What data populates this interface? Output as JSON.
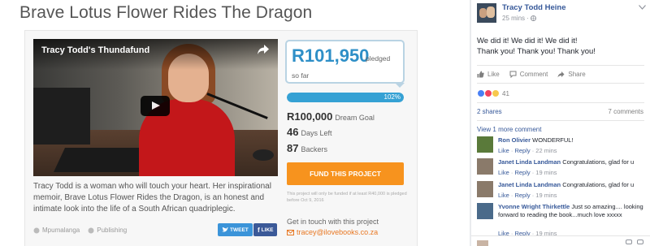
{
  "campaign": {
    "title": "Brave Lotus Flower Rides The Dragon",
    "video_title": "Tracy Todd's Thundafund",
    "description": "Tracy Todd is a woman who will touch your heart. Her inspirational memoir, Brave Lotus Flower Rides the Dragon, is an honest and intimate look into the life of a South African quadriplegic.",
    "tags": [
      "Mpumalanga",
      "Publishing"
    ],
    "tweet_label": "TWEET",
    "like_label": "LIKE",
    "pledged_amount": "R101,950",
    "pledged_label": "pledged",
    "so_far_label": "so far",
    "progress_percent": 102,
    "progress_label": "102%",
    "goal_amount": "R100,000",
    "goal_label": "Dream Goal",
    "days_left": "46",
    "days_left_label": "Days Left",
    "backers": "87",
    "backers_label": "Backers",
    "fund_button": "FUND THIS PROJECT",
    "fund_note": "This project will only be funded if at least R40,000 is pledged before Oct 9, 2016",
    "contact_heading": "Get in touch with this project",
    "contact_email": "tracey@ilovebooks.co.za",
    "colors": {
      "accent": "#2e8fc7",
      "fund_button": "#f7931e",
      "email": "#e87722",
      "progress": "#35a1d4"
    }
  },
  "facebook": {
    "author": "Tracy Todd Heine",
    "time": "25 mins · ",
    "post_line1": "We did it! We did it! We did it!",
    "post_line2": "Thank you! Thank you! Thank you!",
    "actions": {
      "like": "Like",
      "comment": "Comment",
      "share": "Share"
    },
    "reactions_count": "41",
    "shares": "2 shares",
    "comments_count": "7 comments",
    "view_more": "View 1 more comment",
    "comments": [
      {
        "name": "Ron Olivier",
        "text": "WONDERFUL!",
        "like": "Like",
        "reply": "Reply",
        "time": "22 mins"
      },
      {
        "name": "Janet Linda Landman",
        "text": "Congratulations, glad for u",
        "like": "Like",
        "reply": "Reply",
        "time": "19 mins"
      },
      {
        "name": "Janet Linda Landman",
        "text": "Congratulations, glad for u",
        "like": "Like",
        "reply": "Reply",
        "time": "19 mins"
      },
      {
        "name": "Yvonne Wright Thirkettle",
        "text": "Just so amazing.... looking forward to reading the book...much love xxxxx",
        "like": "Like",
        "reply": "Reply",
        "time": "19 mins"
      }
    ],
    "colors": {
      "link": "#365899",
      "meta": "#90949c"
    }
  }
}
